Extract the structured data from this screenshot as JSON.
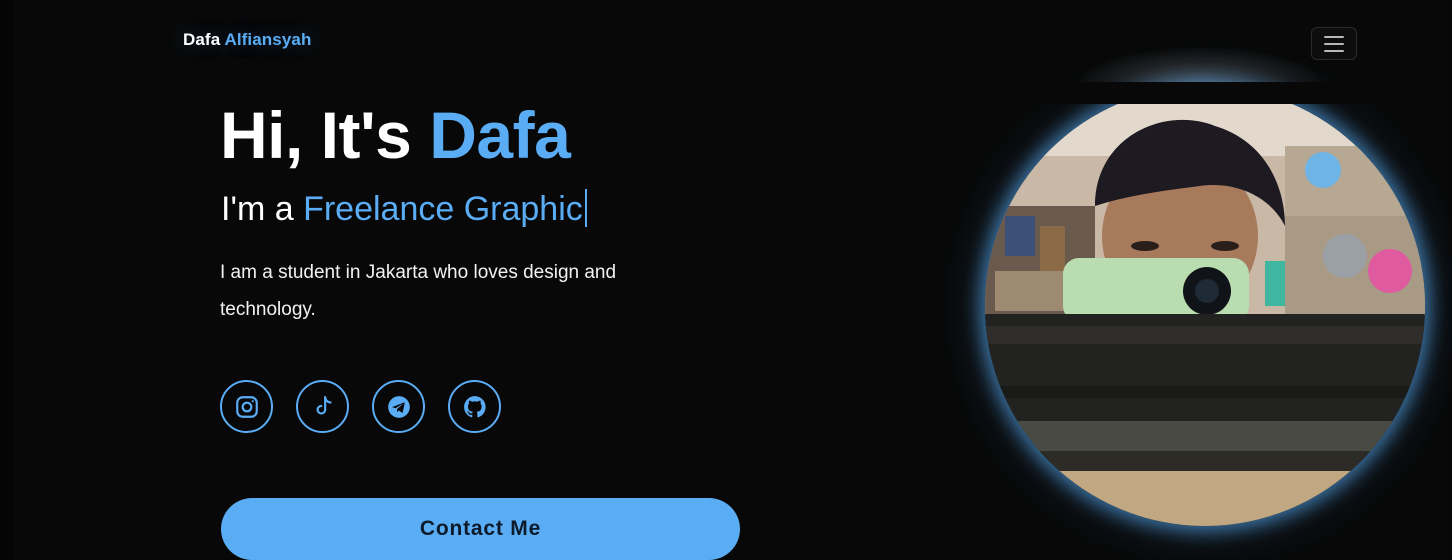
{
  "navbar": {
    "brand_first": "Dafa",
    "brand_last": "Alfiansyah",
    "menu_icon": "hamburger-menu-icon"
  },
  "hero": {
    "greeting": "Hi, It's",
    "name": "Dafa",
    "role_prefix": "I'm a",
    "role_typed": "Freelance Graphic",
    "description": "I am a student in Jakarta who loves design and technology."
  },
  "socials": [
    {
      "name": "instagram",
      "icon": "instagram-icon"
    },
    {
      "name": "tiktok",
      "icon": "tiktok-icon"
    },
    {
      "name": "telegram",
      "icon": "telegram-icon"
    },
    {
      "name": "github",
      "icon": "github-icon"
    }
  ],
  "contact": {
    "label": "Contact Me"
  },
  "profile_image": {
    "subject": "selfie-photo"
  },
  "colors": {
    "accent": "#5aadf5",
    "background": "#080808",
    "text": "#ffffff"
  }
}
